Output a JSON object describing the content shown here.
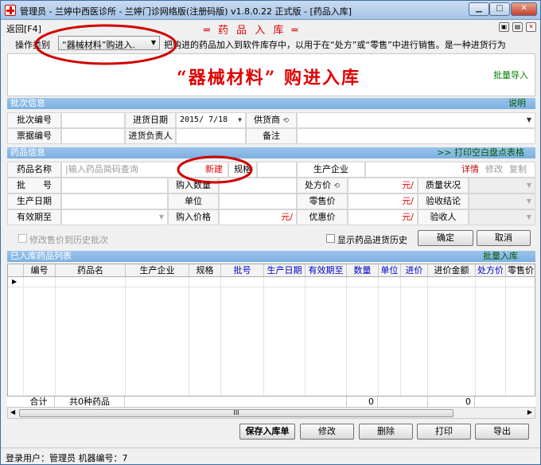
{
  "window": {
    "title": "管理员 - 兰婷中西医诊所 - 兰婷门诊网络版(注册码版) v1.8.0.22 正式版 - [药品入库]",
    "minimize": "▁",
    "maximize": "□",
    "close": "✕"
  },
  "topbar": {
    "back_label": "返回[F4]",
    "center_title": "═   药 品 入 库   ═"
  },
  "operation": {
    "label": "操作类别",
    "selected": "“器械材料”购进入.",
    "description": "把购进的药品加入到软件库存中，以用于在“处方”或“零售”中进行销售。是一种进货行为"
  },
  "banner": {
    "title": "“器械材料” 购进入库",
    "batch_import": "批量导入"
  },
  "batch_section": {
    "header": "批次信息",
    "help": "说明",
    "batch_no_label": "批次编号",
    "batch_no_value": "",
    "date_label": "进货日期",
    "date_value": "2015/ 7/18",
    "supplier_label": "供货商",
    "supplier_value": "",
    "invoice_label": "票据编号",
    "invoice_value": "",
    "buyer_label": "进货负责人",
    "buyer_value": "",
    "remark_label": "备注",
    "remark_value": ""
  },
  "drug_section": {
    "header": "药品信息",
    "print_sheet": ">>  打印空白盘点表格",
    "name_label": "药品名称",
    "name_placeholder": "|输入药品简码查询",
    "new_label": "新建",
    "spec_label": "规格",
    "manufacturer_label": "生产企业",
    "detail_label": "详情",
    "modify_label": "修改",
    "copy_label": "复制",
    "batch_label": "批　　号",
    "purchase_qty_label": "购入数量",
    "rx_price_label": "处方价",
    "rx_price_unit": "元/",
    "quality_label": "质量状况",
    "mfg_date_label": "生产日期",
    "unit_label": "单位",
    "retail_price_label": "零售价",
    "retail_price_unit": "元/",
    "accept_label": "验收结论",
    "expiry_label": "有效期至",
    "purchase_price_label": "购入价格",
    "purchase_price_unit": "元/",
    "discount_price_label": "优惠价",
    "discount_price_unit": "元/",
    "inspector_label": "验收人",
    "edit_price_history": "修改售价到历史批次",
    "show_history": "显示药品进货历史",
    "confirm": "确定",
    "cancel": "取消"
  },
  "list_section": {
    "header": "已入库药品列表",
    "batch_in": "批量入库",
    "columns": [
      "编号",
      "药品名",
      "生产企业",
      "规格",
      "批号",
      "生产日期",
      "有效期至",
      "数量",
      "单位",
      "进价",
      "进价金额",
      "处方价",
      "零售价"
    ],
    "totals": {
      "label": "合计",
      "count_text": "共0种药品",
      "qty": "0",
      "amount": "0"
    },
    "scroll_label": "III"
  },
  "actions": {
    "save": "保存入库单",
    "modify": "修改",
    "delete": "删除",
    "print": "打印",
    "export": "导出"
  },
  "status": {
    "text": "登录用户：管理员  机器编号：7"
  },
  "colors": {
    "accent_red": "#e00000",
    "section_blue": "#7ab0e2",
    "link_green": "#008000"
  }
}
